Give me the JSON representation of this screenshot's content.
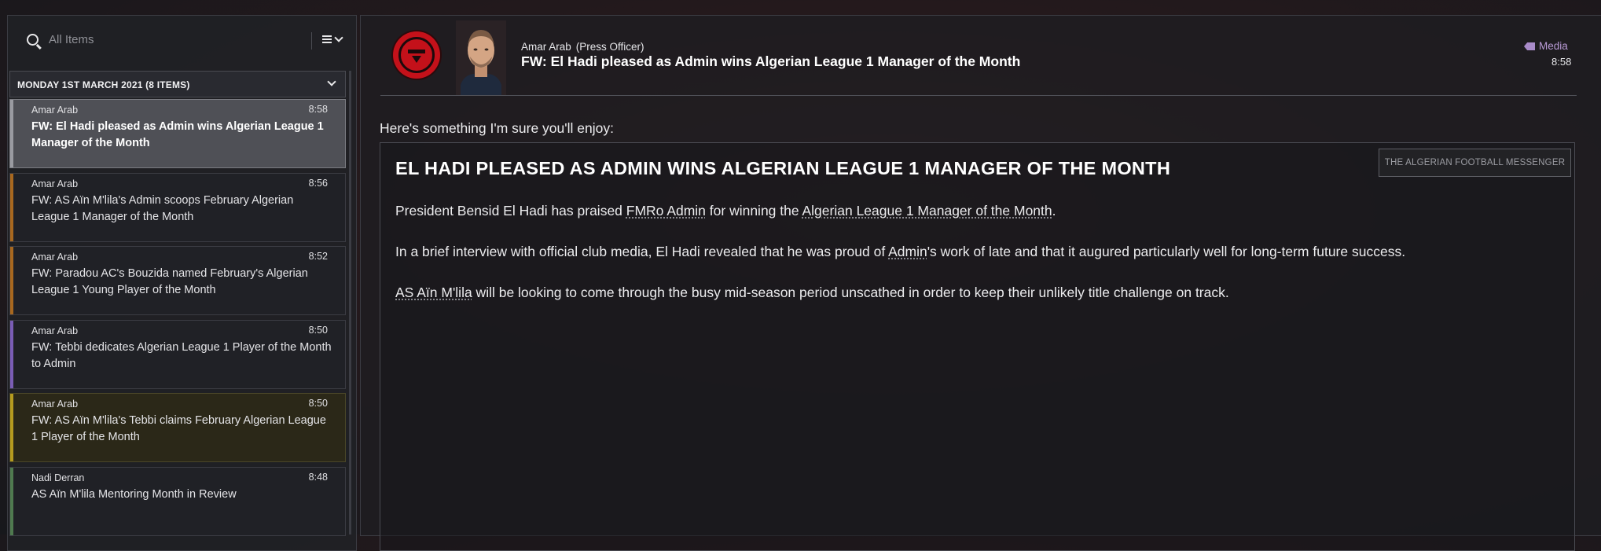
{
  "sidebar": {
    "search": {
      "placeholder": "All Items",
      "icon": "search-icon"
    },
    "list_menu_icon": "list-menu-icon",
    "group": {
      "title": "MONDAY 1ST MARCH 2021 (8 ITEMS)"
    },
    "messages": [
      {
        "sender": "Amar Arab",
        "time": "8:58",
        "subject": "FW: El Hadi pleased as Admin wins Algerian League 1 Manager of the Month",
        "accent": "#9a9ba1"
      },
      {
        "sender": "Amar Arab",
        "time": "8:56",
        "subject": "FW: AS Aïn M'lila's Admin scoops February Algerian League 1 Manager of the Month",
        "accent": "#a8681f"
      },
      {
        "sender": "Amar Arab",
        "time": "8:52",
        "subject": "FW: Paradou AC's Bouzida named February's Algerian League 1 Young Player of the Month",
        "accent": "#a8681f"
      },
      {
        "sender": "Amar Arab",
        "time": "8:50",
        "subject": "FW: Tebbi dedicates Algerian League 1 Player of the Month to Admin",
        "accent": "#7a5db5"
      },
      {
        "sender": "Amar Arab",
        "time": "8:50",
        "subject": "FW: AS Aïn M'lila's Tebbi claims February Algerian League 1 Player of the Month",
        "accent": "#b59b1f"
      },
      {
        "sender": "Nadi Derran",
        "time": "8:48",
        "subject": "AS Aïn M'lila Mentoring Month in Review",
        "accent": "#4f7a4f"
      }
    ]
  },
  "message": {
    "sender_name": "Amar Arab",
    "sender_role": "(Press Officer)",
    "subject": "FW: El Hadi pleased as Admin wins Algerian League 1 Manager of the Month",
    "tag": "Media",
    "time": "8:58",
    "intro": "Here's something I'm sure you'll enjoy:",
    "article": {
      "headline": "EL HADI PLEASED AS ADMIN WINS ALGERIAN LEAGUE 1 MANAGER OF THE MONTH",
      "source": "THE ALGERIAN FOOTBALL MESSENGER",
      "p1": {
        "a": "President Bensid El Hadi has praised ",
        "link1": "FMRo Admin",
        "b": " for winning the ",
        "link2": "Algerian League 1 Manager of the Month",
        "c": "."
      },
      "p2": {
        "a": "In a brief interview with official club media, El Hadi revealed that he was proud of ",
        "link1": "Admin",
        "b": "'s work of late and that it augured particularly well for long-term future success."
      },
      "p3": {
        "link1": "AS Aïn M'lila",
        "a": " will be looking to come through the busy mid-season period unscathed in order to keep their unlikely title challenge on track."
      }
    }
  },
  "colors": {
    "accent_media": "#b99bd6",
    "club_red": "#c4111a"
  }
}
